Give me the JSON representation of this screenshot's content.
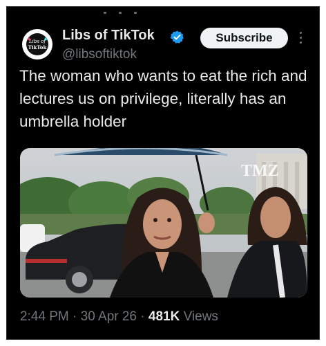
{
  "account": {
    "display_name": "Libs of TikTok",
    "handle": "@libsoftiktok",
    "verified": true,
    "avatar_text_top": "Libs of",
    "avatar_text_bottom": "TikTok",
    "verified_color": "#1d9bf0"
  },
  "actions": {
    "subscribe_label": "Subscribe",
    "more_icon": "more-vertical-icon"
  },
  "post": {
    "text": "The woman who wants to eat the rich and lectures us on privilege, literally has an umbrella holder",
    "media_watermark": "TMZ"
  },
  "meta": {
    "time": "2:44 PM",
    "sep1": " · ",
    "date": "30 Apr 26",
    "sep2": " · ",
    "views_count": "481K",
    "views_label": " Views"
  },
  "colors": {
    "background": "#000000",
    "primary_text": "#e7e9ea",
    "secondary_text": "#71767b",
    "button_bg": "#eff3f4"
  }
}
